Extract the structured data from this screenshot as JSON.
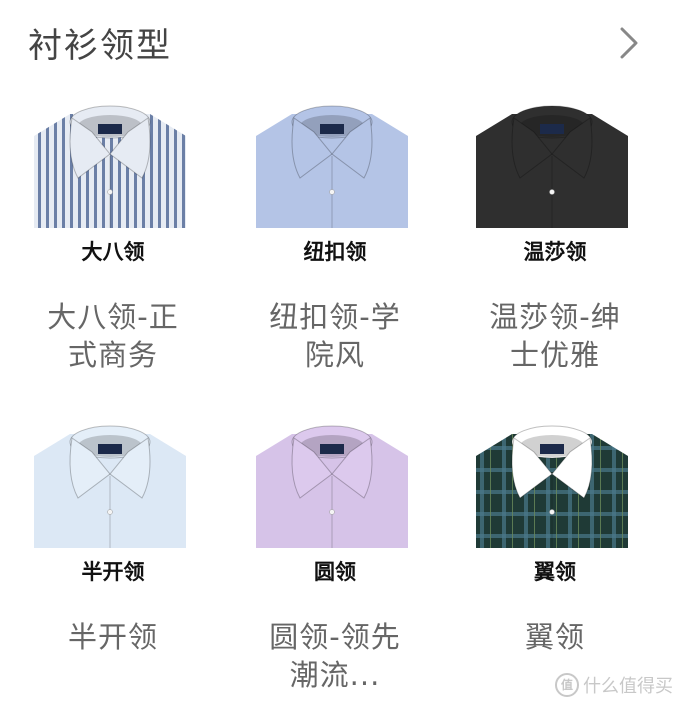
{
  "header": {
    "title": "衬衫领型",
    "more_icon": "chevron-right-icon"
  },
  "items": [
    {
      "label": "大八领",
      "desc_line1": "大八领-正",
      "desc_line2": "式商务",
      "shirt_color": "#e6ebf3",
      "stripe_color": "#6b7fa6",
      "collar_color": "#e6ebf3",
      "pattern": "stripes"
    },
    {
      "label": "纽扣领",
      "desc_line1": "纽扣领-学",
      "desc_line2": "院风",
      "shirt_color": "#b4c4e6",
      "stripe_color": "",
      "collar_color": "#b4c4e6",
      "pattern": "plain"
    },
    {
      "label": "温莎领",
      "desc_line1": "温莎领-绅",
      "desc_line2": "士优雅",
      "shirt_color": "#2f2f2f",
      "stripe_color": "",
      "collar_color": "#2f2f2f",
      "pattern": "plain"
    },
    {
      "label": "半开领",
      "desc_line1": "半开领",
      "desc_line2": "",
      "shirt_color": "#dce8f5",
      "stripe_color": "",
      "collar_color": "#e4eef8",
      "pattern": "plain"
    },
    {
      "label": "圆领",
      "desc_line1": "圆领-领先",
      "desc_line2": "潮流...",
      "shirt_color": "#d6c3e8",
      "stripe_color": "",
      "collar_color": "#dcc9ed",
      "pattern": "plain"
    },
    {
      "label": "翼领",
      "desc_line1": "翼领",
      "desc_line2": "",
      "shirt_color": "#1f3a36",
      "stripe_color": "#4a7a8a",
      "collar_color": "#ffffff",
      "pattern": "tartan"
    }
  ],
  "watermark": {
    "icon_text": "值",
    "text": "什么值得买"
  }
}
